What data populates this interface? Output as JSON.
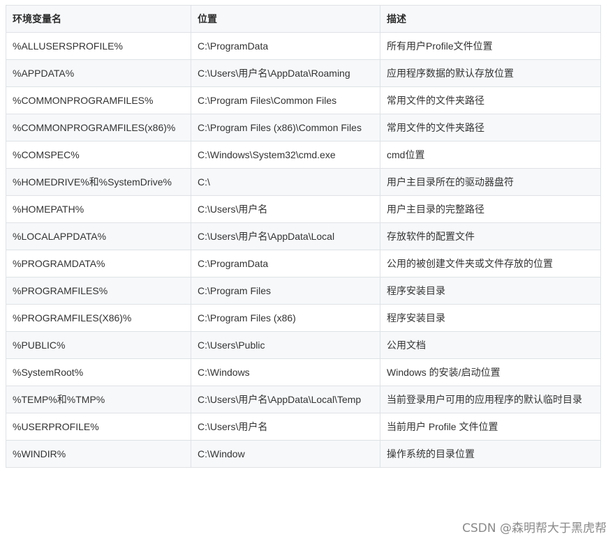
{
  "table": {
    "headers": [
      "环境变量名",
      "位置",
      "描述"
    ],
    "rows": [
      [
        "%ALLUSERSPROFILE%",
        "C:\\ProgramData",
        "所有用户Profile文件位置"
      ],
      [
        "%APPDATA%",
        "C:\\Users\\用户名\\AppData\\Roaming",
        "应用程序数据的默认存放位置"
      ],
      [
        "%COMMONPROGRAMFILES%",
        "C:\\Program Files\\Common Files",
        "常用文件的文件夹路径"
      ],
      [
        "%COMMONPROGRAMFILES(x86)%",
        "C:\\Program Files (x86)\\Common Files",
        "常用文件的文件夹路径"
      ],
      [
        "%COMSPEC%",
        "C:\\Windows\\System32\\cmd.exe",
        "cmd位置"
      ],
      [
        "%HOMEDRIVE%和%SystemDrive%",
        "C:\\",
        "用户主目录所在的驱动器盘符"
      ],
      [
        "%HOMEPATH%",
        "C:\\Users\\用户名",
        "用户主目录的完整路径"
      ],
      [
        "%LOCALAPPDATA%",
        "C:\\Users\\用户名\\AppData\\Local",
        "存放软件的配置文件"
      ],
      [
        "%PROGRAMDATA%",
        "C:\\ProgramData",
        "公用的被创建文件夹或文件存放的位置"
      ],
      [
        "%PROGRAMFILES%",
        "C:\\Program Files",
        "程序安装目录"
      ],
      [
        "%PROGRAMFILES(X86)%",
        "C:\\Program Files (x86)",
        "程序安装目录"
      ],
      [
        "%PUBLIC%",
        "C:\\Users\\Public",
        "公用文档"
      ],
      [
        "%SystemRoot%",
        "C:\\Windows",
        "Windows 的安装/启动位置"
      ],
      [
        "%TEMP%和%TMP%",
        "C:\\Users\\用户名\\AppData\\Local\\Temp",
        "当前登录用户可用的应用程序的默认临时目录"
      ],
      [
        "%USERPROFILE%",
        "C:\\Users\\用户名",
        "当前用户 Profile 文件位置"
      ],
      [
        "%WINDIR%",
        "C:\\Window",
        "操作系统的目录位置"
      ]
    ]
  },
  "watermark": "CSDN @森明帮大于黑虎帮"
}
